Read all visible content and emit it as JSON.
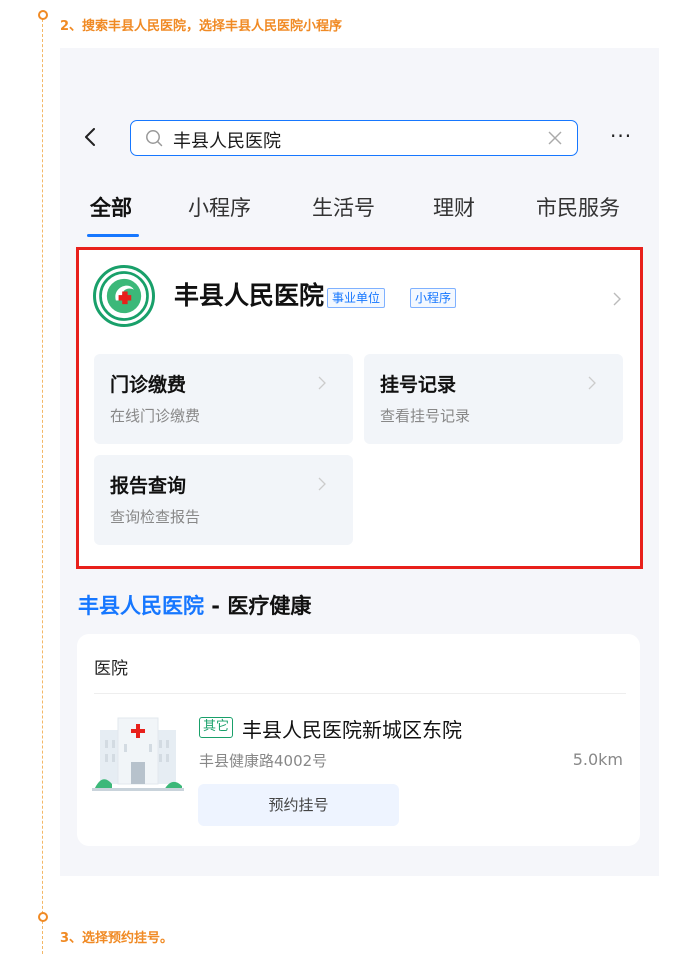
{
  "steps": {
    "step2": "2、搜索丰县人民医院，选择丰县人民医院小程序",
    "step3": "3、选择预约挂号。"
  },
  "search": {
    "query": "丰县人民医院"
  },
  "tabs": [
    "全部",
    "小程序",
    "生活号",
    "理财",
    "市民服务"
  ],
  "result": {
    "name": "丰县人民医院",
    "tags": [
      "事业单位",
      "小程序"
    ],
    "services": [
      {
        "title": "门诊缴费",
        "subtitle": "在线门诊缴费"
      },
      {
        "title": "挂号记录",
        "subtitle": "查看挂号记录"
      },
      {
        "title": "报告查询",
        "subtitle": "查询检查报告"
      }
    ]
  },
  "section": {
    "title_highlight": "丰县人民医院",
    "title_rest": " - 医疗健康",
    "category": "医院",
    "place": {
      "tag": "其它",
      "name": "丰县人民医院新城区东院",
      "address": "丰县健康路4002号",
      "distance": "5.0km",
      "button": "预约挂号"
    }
  },
  "colors": {
    "accent": "#1677ff",
    "highlight_border": "#e8201b",
    "step_orange": "#f08a24",
    "green": "#19a06a"
  }
}
